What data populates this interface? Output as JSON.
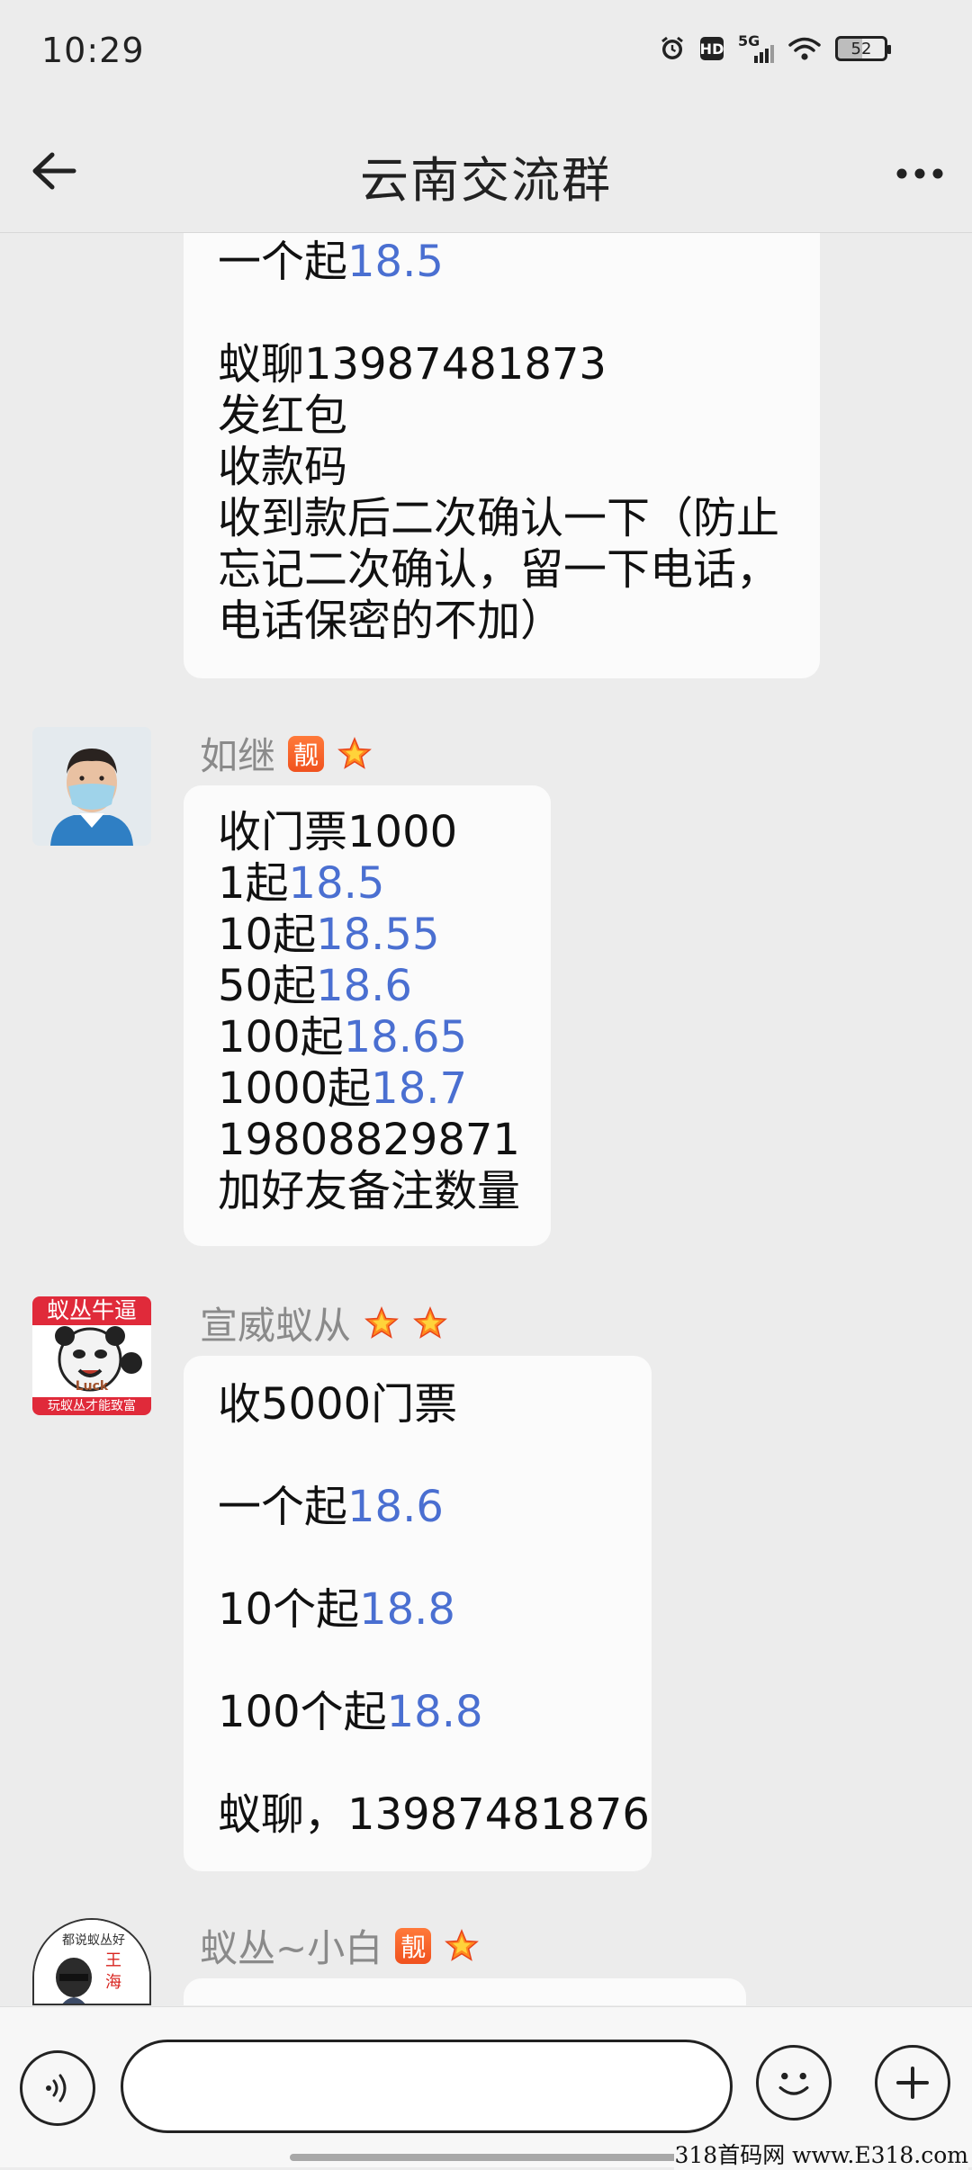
{
  "status_bar": {
    "time": "10:29",
    "hd": "HD",
    "network": "5G",
    "battery": "52"
  },
  "header": {
    "title": "云南交流群"
  },
  "messages": [
    {
      "lines": [
        {
          "t": "一个起",
          "n": "18.5"
        },
        {
          "t": ""
        },
        {
          "t": "蚁聊13987481873"
        },
        {
          "t": "发红包"
        },
        {
          "t": "收款码"
        },
        {
          "t": "收到款后二次确认一下（防止"
        },
        {
          "t": "忘记二次确认，留一下电话，"
        },
        {
          "t": "电话保密的不加）"
        }
      ]
    },
    {
      "sender": "如继",
      "badge": "靓",
      "stars": 1,
      "lines": [
        {
          "t": "收门票1000"
        },
        {
          "t": "1起",
          "n": "18.5"
        },
        {
          "t": "10起",
          "n": "18.55"
        },
        {
          "t": "50起",
          "n": "18.6"
        },
        {
          "t": "100起",
          "n": "18.65"
        },
        {
          "t": "1000起",
          "n": "18.7"
        },
        {
          "t": "19808829871"
        },
        {
          "t": "加好友备注数量"
        }
      ]
    },
    {
      "sender": "宣威蚁从",
      "stars": 2,
      "avatar_text_top": "蚁丛牛逼",
      "avatar_text_mid": "Luck",
      "avatar_text_bottom": "玩蚁丛才能致富",
      "lines": [
        {
          "t": "收5000门票"
        },
        {
          "t": ""
        },
        {
          "t": "一个起",
          "n": "18.6"
        },
        {
          "t": ""
        },
        {
          "t": "10个起",
          "n": "18.8"
        },
        {
          "t": ""
        },
        {
          "t": "100个起",
          "n": "18.8"
        },
        {
          "t": ""
        },
        {
          "t": "蚁聊，13987481876"
        }
      ]
    },
    {
      "sender": "蚁丛~小白",
      "badge": "靓",
      "stars": 1,
      "avatar_text_top": "都说蚁丛好",
      "avatar_text_name": "王 海"
    }
  ],
  "colors": {
    "background": "#ececec",
    "bubble": "#fbfbfb",
    "number_highlight": "#4a6fd1",
    "badge": "#f0521e"
  },
  "watermark": "318首码网 www.E318.com"
}
